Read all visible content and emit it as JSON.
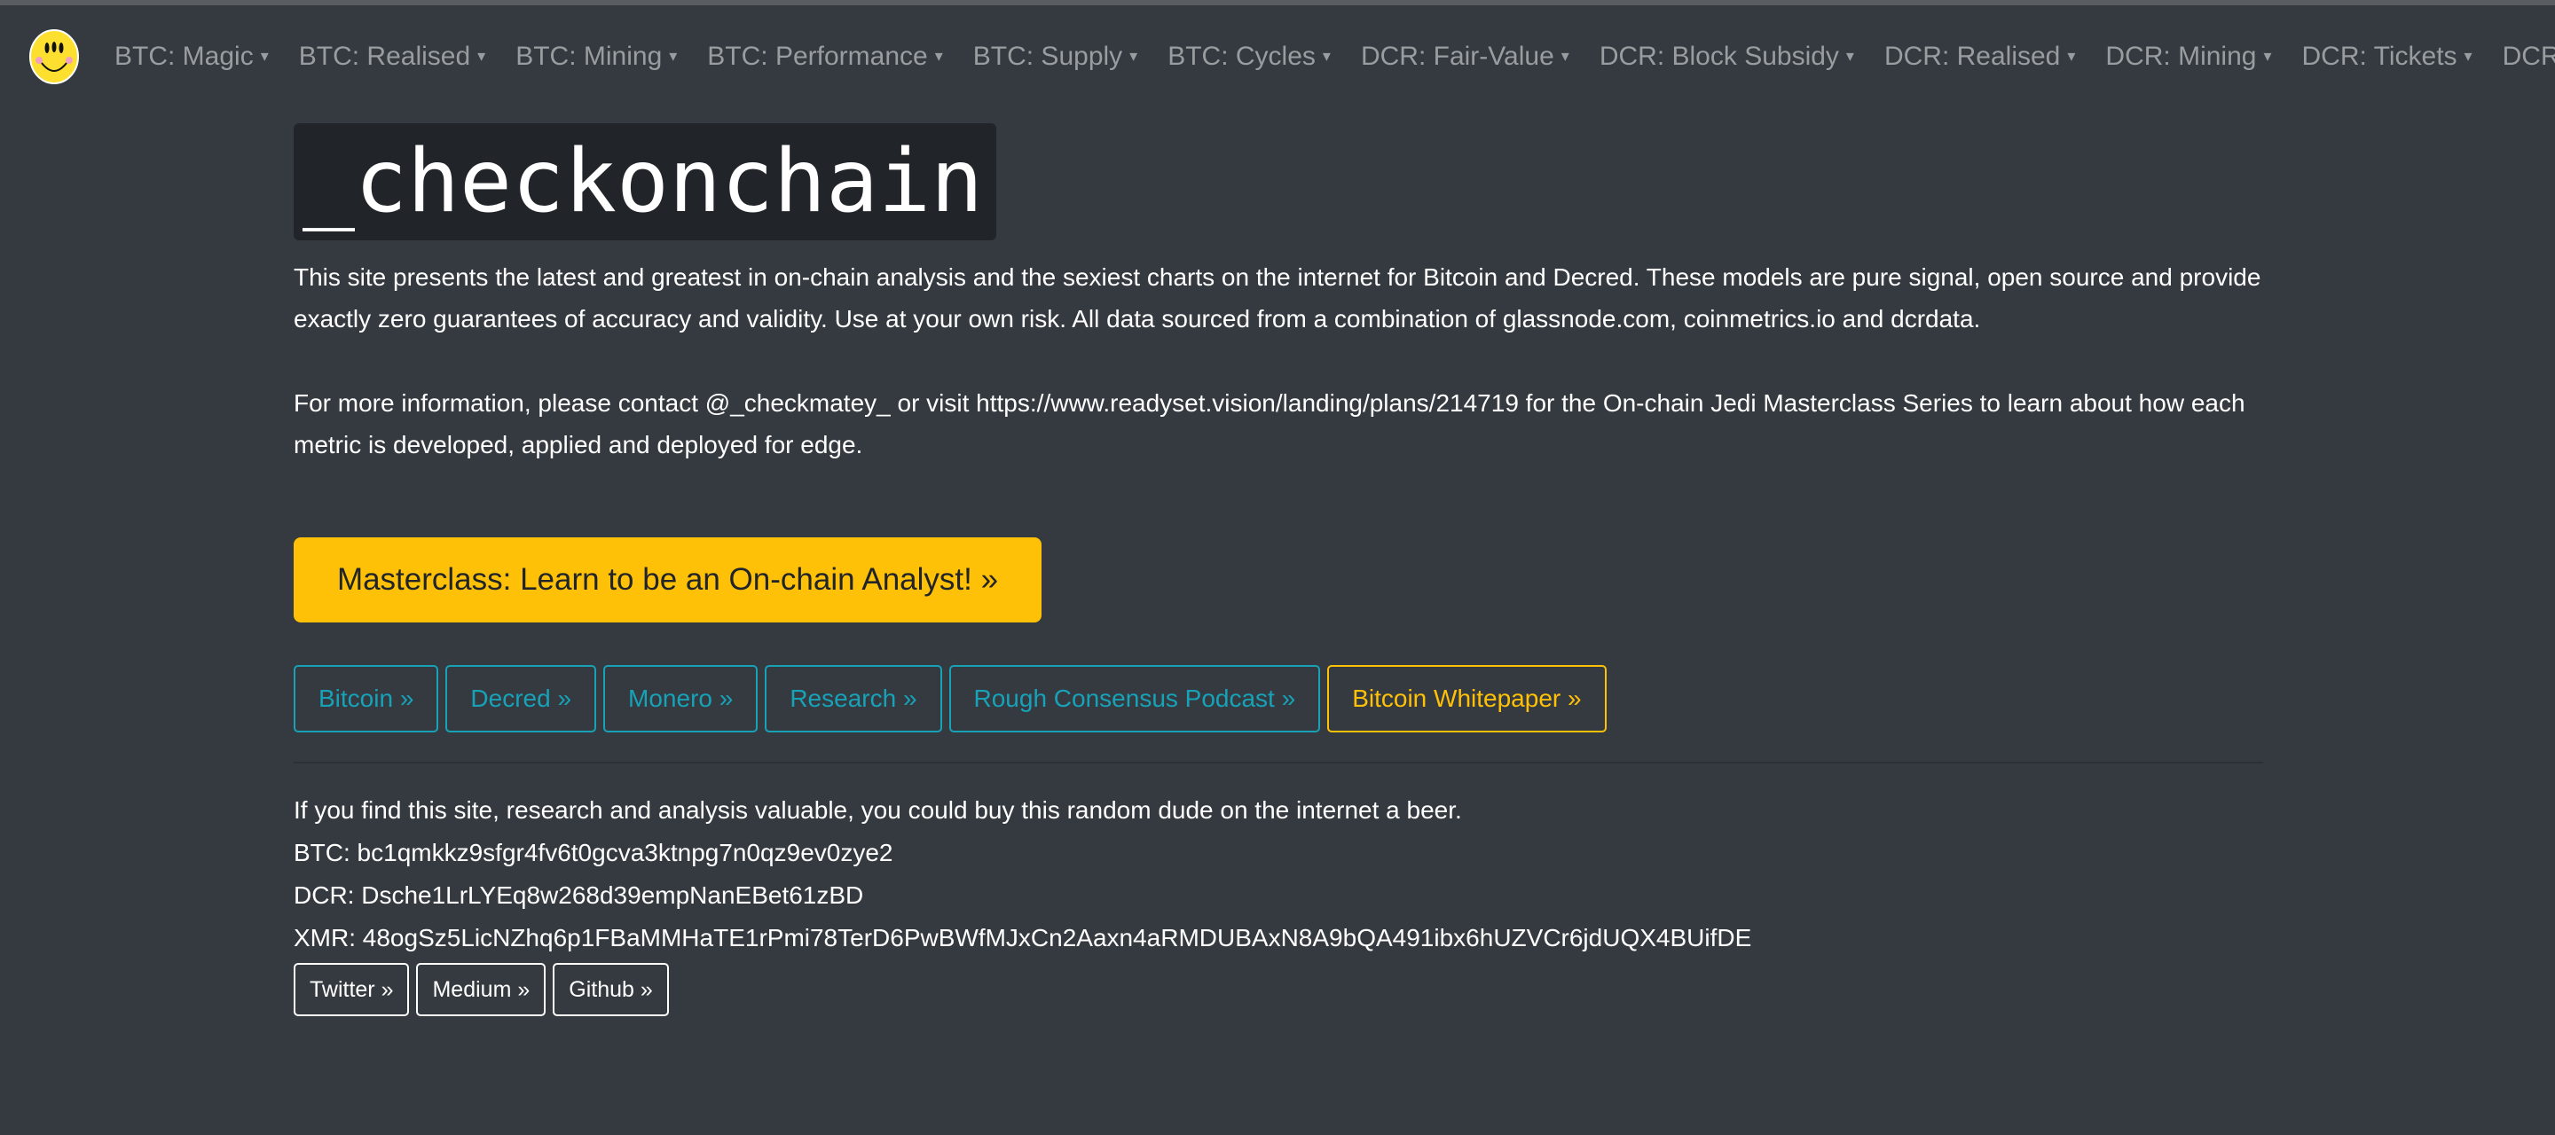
{
  "nav": {
    "items": [
      {
        "label": "BTC: Magic"
      },
      {
        "label": "BTC: Realised"
      },
      {
        "label": "BTC: Mining"
      },
      {
        "label": "BTC: Performance"
      },
      {
        "label": "BTC: Supply"
      },
      {
        "label": "BTC: Cycles"
      },
      {
        "label": "DCR: Fair-Value"
      },
      {
        "label": "DCR: Block Subsidy"
      },
      {
        "label": "DCR: Realised"
      },
      {
        "label": "DCR: Mining"
      },
      {
        "label": "DCR: Tickets"
      },
      {
        "label": "DCR: P"
      }
    ],
    "caret": "▾"
  },
  "title": "_checkonchain",
  "intro": "This site presents the latest and greatest in on-chain analysis and the sexiest charts on the internet for Bitcoin and Decred. These models are pure signal, open source and provide exactly zero guarantees of accuracy and validity. Use at your own risk. All data sourced from a combination of glassnode.com, coinmetrics.io and dcrdata.",
  "contact": "For more information, please contact @_checkmatey_ or visit https://www.readyset.vision/landing/plans/214719 for the On-chain Jedi Masterclass Series to learn about how each metric is developed, applied and deployed for edge.",
  "masterclass_button": "Masterclass: Learn to be an On-chain Analyst! »",
  "buttons": [
    "Bitcoin »",
    "Decred »",
    "Monero »",
    "Research »",
    "Rough Consensus Podcast »",
    "Bitcoin Whitepaper »"
  ],
  "donate": {
    "text": "If you find this site, research and analysis valuable, you could buy this random dude on the internet a beer.",
    "btc": "BTC: bc1qmkkz9sfgr4fv6t0gcva3ktnpg7n0qz9ev0zye2",
    "dcr": "DCR: Dsche1LrLYEq8w268d39empNanEBet61zBD",
    "xmr": "XMR: 48ogSz5LicNZhq6p1FBaMMHaTE1rPmi78TerD6PwBWfMJxCn2Aaxn4aRMDUBAxN8A9bQA491ibx6hUZVCr6jdUQX4BUifDE"
  },
  "social": [
    "Twitter »",
    "Medium »",
    "Github »"
  ],
  "colors": {
    "background": "#343a40",
    "accent": "#ffc107",
    "info": "#17a2b8"
  }
}
